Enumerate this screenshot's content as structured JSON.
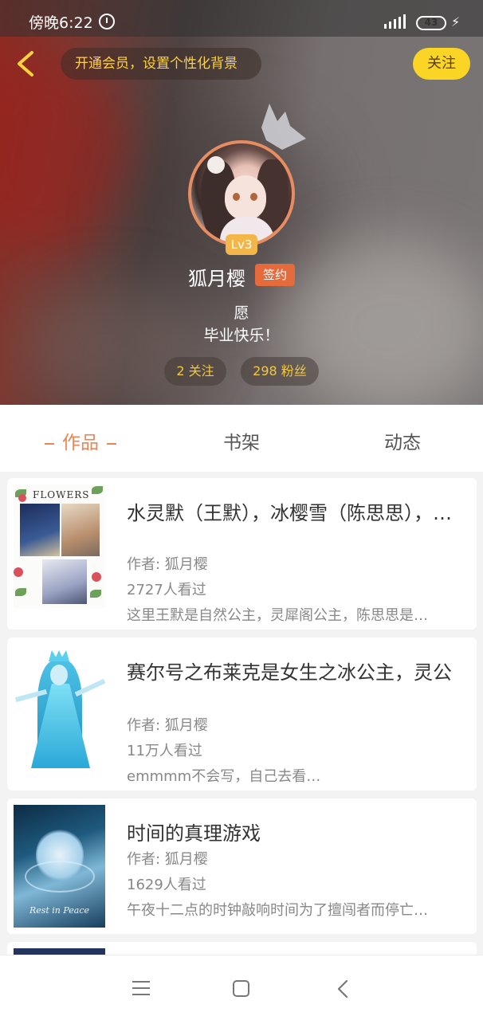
{
  "status_bar": {
    "time": "傍晚6:22",
    "network": "4G",
    "battery": "43"
  },
  "header": {
    "vip_prompt": "开通会员，设置个性化背景",
    "follow_label": "关注",
    "level": "Lv3",
    "username": "狐月樱",
    "sign_badge": "签约",
    "bio_line1": "愿",
    "bio_line2": "毕业快乐！",
    "following": "2 关注",
    "fans": "298 粉丝"
  },
  "tabs": [
    {
      "label": "作品",
      "active": true
    },
    {
      "label": "书架",
      "active": false
    },
    {
      "label": "动态",
      "active": false
    }
  ],
  "works": [
    {
      "title": "水灵默（王默），冰樱雪（陈思思），…",
      "author": "作者: 狐月樱",
      "views": "2727人看过",
      "desc": "这里王默是自然公主，灵犀阁公主，陈思思是…",
      "cover_text": "FLOWERS"
    },
    {
      "title": "赛尔号之布莱克是女生之冰公主，灵公",
      "author": "作者: 狐月樱",
      "views": "11万人看过",
      "desc": "emmmm不会写，自己去看…"
    },
    {
      "title": "时间的真理游戏",
      "author": "作者: 狐月樱",
      "views": "1629人看过",
      "desc": "午夜十二点的时钟敲响时间为了擅闯者而停亡…",
      "cover_text": "Rest in Peace"
    }
  ],
  "colors": {
    "accent": "#e88756",
    "follow_button": "#fbd526",
    "vip_text": "#ffd33d",
    "sign_badge": "#e56a3c",
    "level_badge": "#f2b64a"
  }
}
